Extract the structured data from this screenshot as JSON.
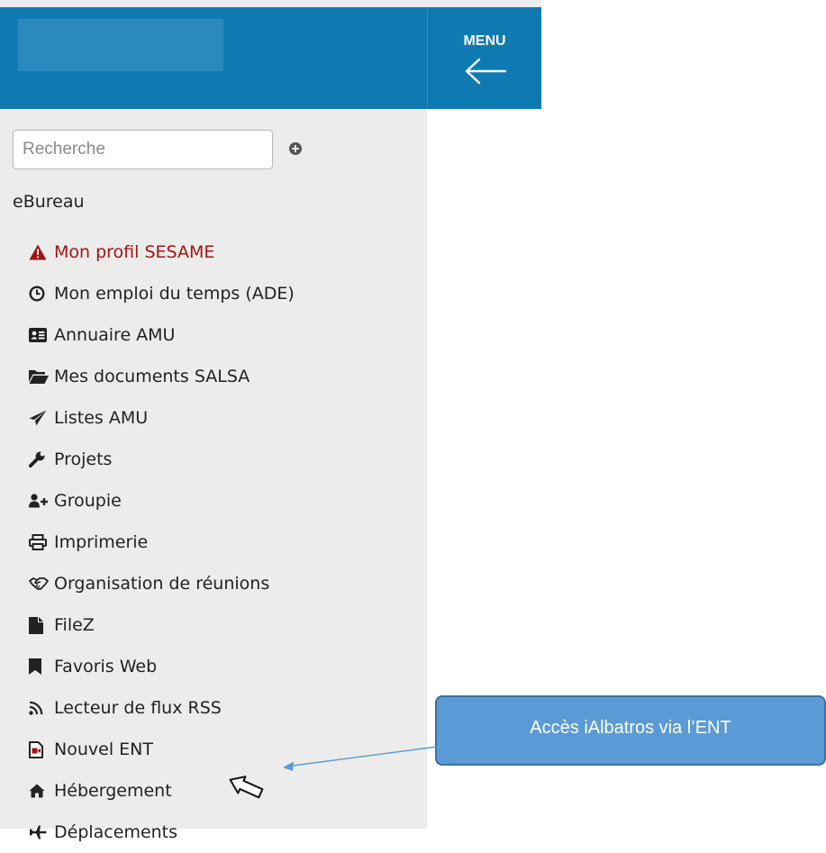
{
  "header": {
    "menu_label": "MENU",
    "menu_icon": "arrow-left-icon",
    "background_color": "#0f7ab1"
  },
  "search": {
    "placeholder": "Recherche",
    "value": "",
    "add_icon": "plus-circle-icon"
  },
  "sidebar": {
    "section_title": "eBureau",
    "items": [
      {
        "label": "Mon profil SESAME",
        "icon": "warning-icon",
        "color": "#a41313"
      },
      {
        "label": "Mon emploi du temps (ADE)",
        "icon": "clock-icon"
      },
      {
        "label": "Annuaire AMU",
        "icon": "id-card-icon"
      },
      {
        "label": "Mes documents SALSA",
        "icon": "folder-open-icon"
      },
      {
        "label": "Listes AMU",
        "icon": "paper-plane-icon"
      },
      {
        "label": "Projets",
        "icon": "wrench-icon"
      },
      {
        "label": "Groupie",
        "icon": "user-plus-icon"
      },
      {
        "label": "Imprimerie",
        "icon": "printer-icon"
      },
      {
        "label": "Organisation de réunions",
        "icon": "handshake-icon"
      },
      {
        "label": "FileZ",
        "icon": "file-icon"
      },
      {
        "label": "Favoris Web",
        "icon": "bookmark-icon"
      },
      {
        "label": "Lecteur de flux RSS",
        "icon": "rss-icon"
      },
      {
        "label": "Nouvel ENT",
        "icon": "video-file-icon"
      },
      {
        "label": "Hébergement",
        "icon": "home-icon"
      },
      {
        "label": "Déplacements",
        "icon": "plane-icon"
      }
    ]
  },
  "annotation": {
    "callout_text": "Accès iAlbatros via l’ENT",
    "callout_color": "#5b9bd5",
    "pointer_icon": "hand-pointer-icon"
  }
}
